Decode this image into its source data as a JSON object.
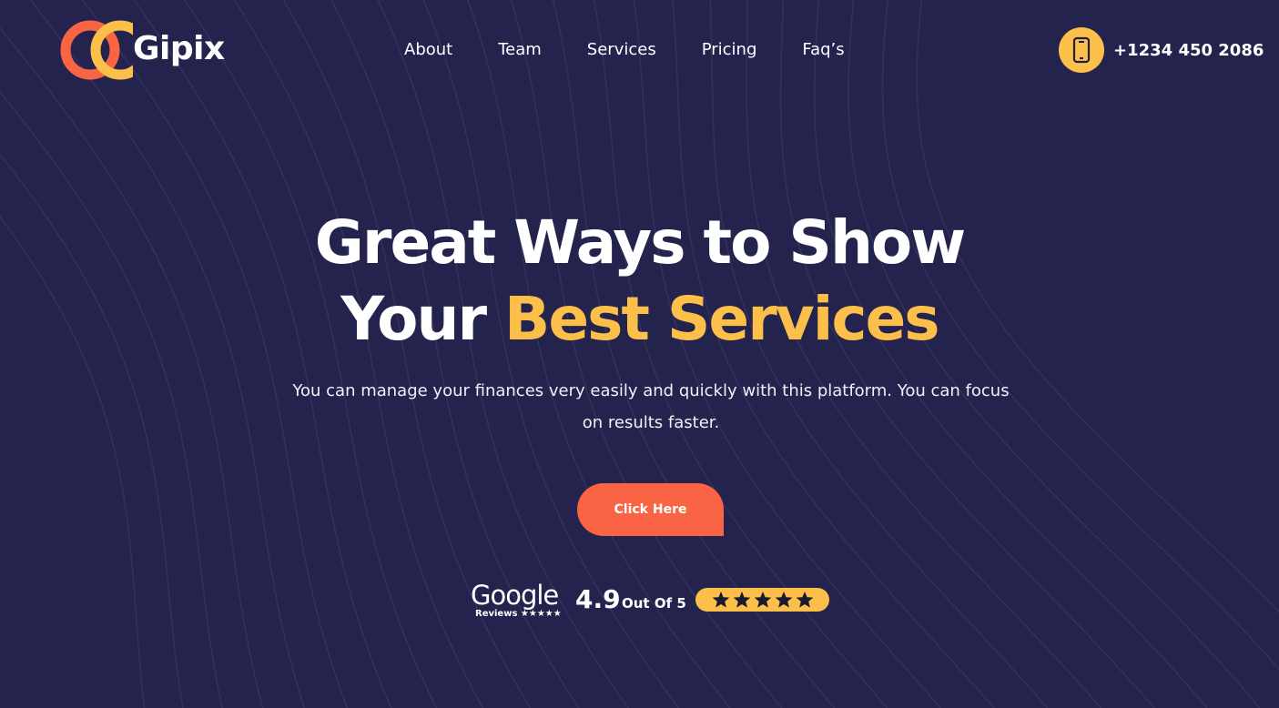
{
  "brand": {
    "name": "Gipix",
    "colors": {
      "primary_orange": "#f86444",
      "accent_yellow": "#fbbf4a",
      "background": "#23234d"
    }
  },
  "nav": {
    "items": [
      {
        "label": "About"
      },
      {
        "label": "Team"
      },
      {
        "label": "Services"
      },
      {
        "label": "Pricing"
      },
      {
        "label": "Faq’s"
      }
    ]
  },
  "contact": {
    "phone": "+1234 450 2086",
    "icon": "phone-icon"
  },
  "hero": {
    "title_line1": "Great Ways to Show",
    "title_line2_lead": "Your ",
    "title_line2_accent": "Best Services",
    "subtitle": "You can manage your finances very easily and quickly with this platform. You can focus on results faster.",
    "cta_label": "Click Here"
  },
  "reviews": {
    "provider": "Google",
    "provider_sub": "Reviews ★★★★★",
    "rating": "4.9",
    "rating_label": "Out Of 5",
    "stars": 5
  }
}
